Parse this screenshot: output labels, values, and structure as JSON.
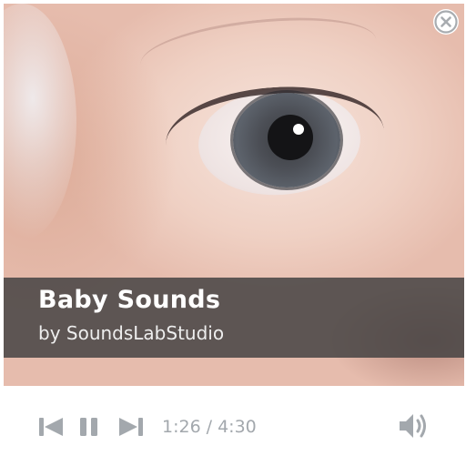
{
  "track": {
    "title": "Baby Sounds",
    "artist": "by SoundsLabStudio"
  },
  "playback": {
    "current_time": "1:26",
    "separator": "/",
    "duration": "4:30",
    "progress_fraction": 0.3185,
    "state": "playing"
  },
  "icons": {
    "close": "close-circle-icon",
    "previous": "skip-previous-icon",
    "pause": "pause-icon",
    "next": "skip-next-icon",
    "volume": "volume-icon"
  },
  "colors": {
    "control_gray": "#a3a8ad",
    "overlay": "#464444",
    "title_text": "#ffffff"
  }
}
